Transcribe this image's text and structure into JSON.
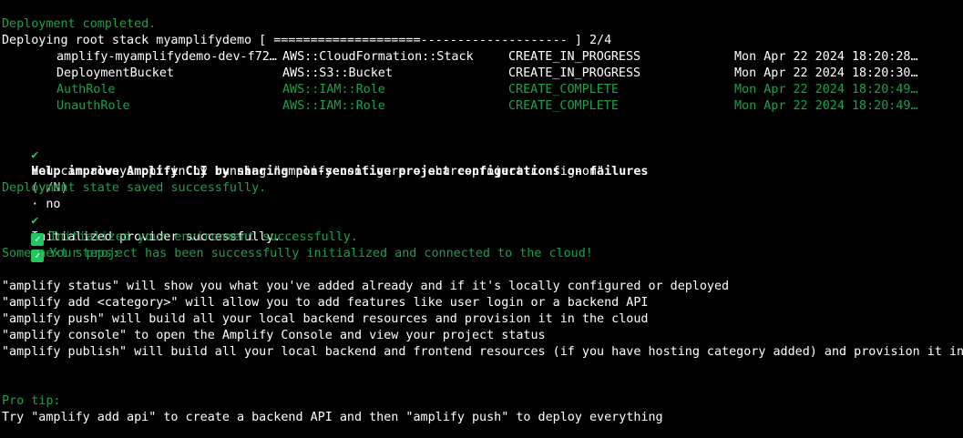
{
  "colors": {
    "background": "#000000",
    "text": "#ffffff",
    "success_green": "#16a34a",
    "check_green": "#22c55e",
    "muted": "#bfbfbf"
  },
  "lines": {
    "deployment_completed": "Deployment completed.",
    "deploying_root_stack": "Deploying root stack myamplifydemo [ ====================-------------------- ] 2/4",
    "help_prompt_check": "✔",
    "help_prompt_question": "Help improve Amplify CLI by sharing non-sensitive project configurations on failures",
    "help_prompt_options": "(y/N)",
    "help_prompt_answer": "· no",
    "opt_in_hint": "    You can always opt-in by running \"amplify configure --share-project-config-on\"",
    "deployment_state_saved": "Deployment state saved successfully.",
    "initialized_provider_check": "✔",
    "initialized_provider": "Initialized provider successfully.",
    "initialized_environment_icon": "check-mark-button-icon",
    "initialized_environment": "Initialized your environment successfully.",
    "project_initialized_icon": "check-mark-button-icon",
    "project_initialized": "Your project has been successfully initialized and connected to the cloud!",
    "some_next_steps": "Some next steps:",
    "step_status": "\"amplify status\" will show you what you've added already and if it's locally configured or deployed",
    "step_add": "\"amplify add <category>\" will allow you to add features like user login or a backend API",
    "step_push": "\"amplify push\" will build all your local backend resources and provision it in the cloud",
    "step_console": "\"amplify console\" to open the Amplify Console and view your project status",
    "step_publish": "\"amplify publish\" will build all your local backend and frontend resources (if you have hosting category added) and provision it in",
    "pro_tip_label": "Pro tip:",
    "pro_tip_text": "Try \"amplify add api\" to create a backend API and then \"amplify push\" to deploy everything"
  },
  "stack_resources": [
    {
      "name": "amplify-myamplifydemo-dev-f72…",
      "type": "AWS::CloudFormation::Stack",
      "status": "CREATE_IN_PROGRESS",
      "time": "Mon Apr 22 2024 18:20:28…"
    },
    {
      "name": "DeploymentBucket",
      "type": "AWS::S3::Bucket",
      "status": "CREATE_IN_PROGRESS",
      "time": "Mon Apr 22 2024 18:20:30…"
    },
    {
      "name": "AuthRole",
      "type": "AWS::IAM::Role",
      "status": "CREATE_COMPLETE",
      "time": "Mon Apr 22 2024 18:20:49…"
    },
    {
      "name": "UnauthRole",
      "type": "AWS::IAM::Role",
      "status": "CREATE_COMPLETE",
      "time": "Mon Apr 22 2024 18:20:49…"
    }
  ]
}
